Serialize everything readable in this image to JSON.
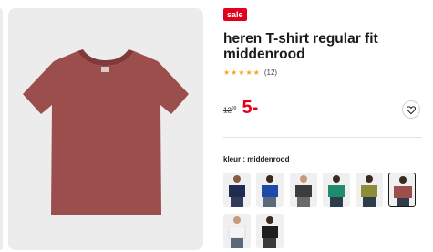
{
  "badge": "sale",
  "product": {
    "title": "heren T-shirt regular fit middenrood",
    "rating_count": "(12)",
    "stars": 5
  },
  "price": {
    "old_main": "12",
    "old_cents": "99",
    "new": "5-"
  },
  "color": {
    "label": "kleur : middenrood",
    "selected_index": 5
  },
  "icons": {
    "wishlist": "heart-icon",
    "star": "star-icon"
  },
  "colors": {
    "sale_red": "#e2001a",
    "shirt_main": "#9c4e4c",
    "swatches": [
      "#1f2b4f",
      "#1d49a8",
      "#3c3c3c",
      "#1f8c6a",
      "#8c8c3a",
      "#9c4e4c",
      "#f4f4f4",
      "#1e1e1e"
    ]
  }
}
